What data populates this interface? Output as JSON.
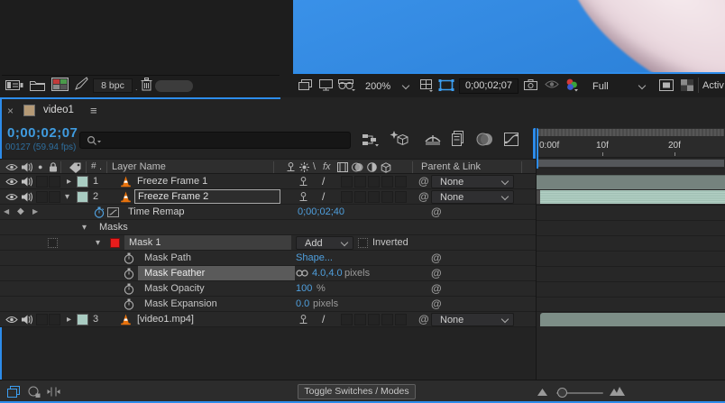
{
  "colors": {
    "accent": "#2d8ceb",
    "blue-text": "#4f9fdd",
    "timecode-blue": "#3f9bdf",
    "frames-blue": "#2e6e9e",
    "label-teal": "#a9ccc2",
    "bar-muted": "#75837e",
    "bar-selected": "#a9cabd",
    "bar-video": "#7d8e87",
    "mask-red": "#ea1c1c",
    "cone-orange": "#e8720c",
    "sky-blue": "#2f8be7"
  },
  "icons": {
    "close": "×",
    "menu": "≡",
    "pick_whip": "@",
    "quality_best": "/",
    "draft_quality": "\\",
    "fx": "fx",
    "hash": "#",
    "dot": ".",
    "twirl_open": "▾",
    "twirl_closed": "▸",
    "key_prev": "◀",
    "key_diamond": "◆",
    "key_next": "▶",
    "solo_dot": "●"
  },
  "project_panel": {
    "bpc_label": "8 bpc"
  },
  "comp_panel": {
    "zoom_level": "200%",
    "timecode": "0;00;02;07",
    "resolution": "Full",
    "right_cutoff": "Activ"
  },
  "timeline": {
    "tab": {
      "title": "video1"
    },
    "current_time": "0;00;02;07",
    "frame_info": "00127 (59.94 fps)",
    "ruler": {
      "ticks": [
        "0:00f",
        "10f",
        "20f"
      ]
    },
    "columns": {
      "number": "#",
      "layer_name": "Layer Name",
      "parent_link": "Parent & Link"
    },
    "layers": [
      {
        "index": "1",
        "name": "Freeze Frame 1",
        "parent": "None"
      },
      {
        "index": "2",
        "name": "Freeze Frame 2",
        "parent": "None"
      },
      {
        "index": "3",
        "name": "[video1.mp4]",
        "parent": "None"
      }
    ],
    "properties": {
      "time_remap": {
        "label": "Time Remap",
        "value": "0;00;02;40"
      },
      "masks_group_label": "Masks",
      "mask": {
        "name": "Mask 1",
        "mode": "Add",
        "inverted": "Inverted"
      },
      "mask_path": {
        "label": "Mask Path",
        "value": "Shape..."
      },
      "mask_feather": {
        "label": "Mask Feather",
        "value": "4.0,4.0",
        "unit": "pixels"
      },
      "mask_opacity": {
        "label": "Mask Opacity",
        "value": "100",
        "unit": "%"
      },
      "mask_expansion": {
        "label": "Mask Expansion",
        "value": "0.0",
        "unit": "pixels"
      }
    },
    "footer": {
      "toggle_label": "Toggle Switches / Modes"
    }
  }
}
